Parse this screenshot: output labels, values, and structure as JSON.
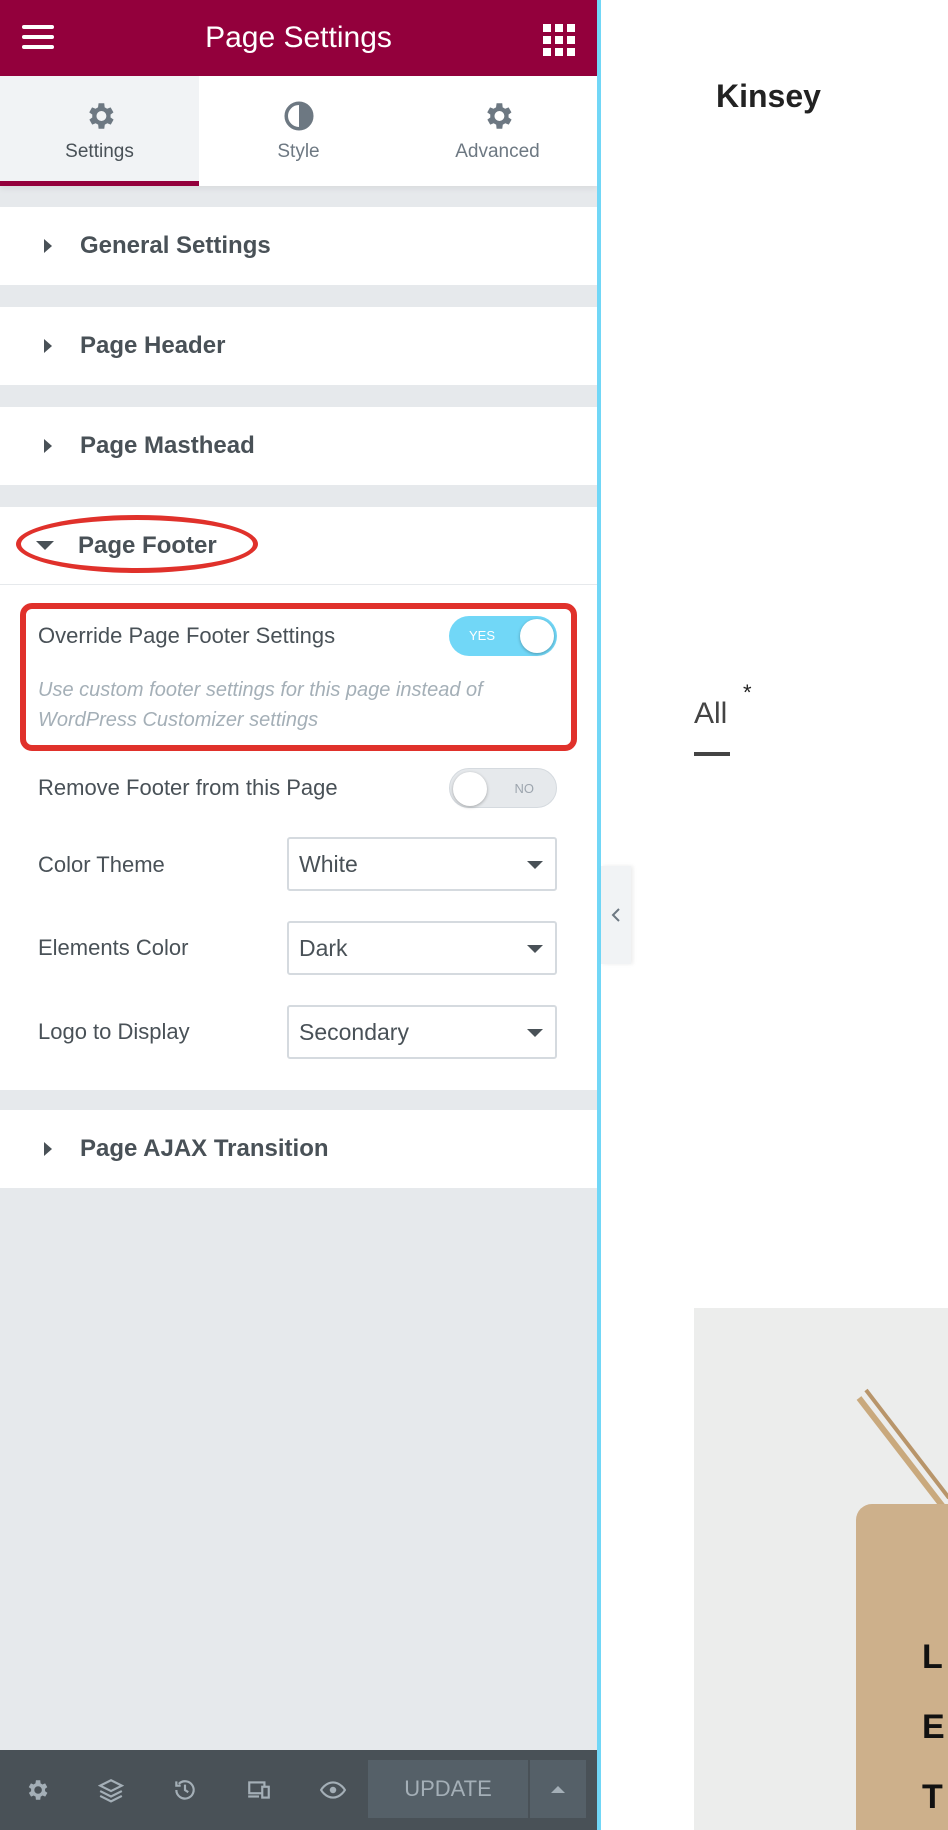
{
  "colors": {
    "brand": "#93003c",
    "toggle_on": "#71d7f7",
    "annotation": "#e0312b"
  },
  "header": {
    "title": "Page Settings",
    "menu_icon": "hamburger-icon",
    "apps_icon": "grid-icon"
  },
  "tabs": [
    {
      "label": "Settings",
      "icon": "gear-icon",
      "active": true
    },
    {
      "label": "Style",
      "icon": "half-circle-icon",
      "active": false
    },
    {
      "label": "Advanced",
      "icon": "gear-icon",
      "active": false
    }
  ],
  "sections": {
    "general": "General Settings",
    "header": "Page Header",
    "masthead": "Page Masthead",
    "footer": "Page Footer",
    "ajax": "Page AJAX Transition"
  },
  "footer_controls": {
    "override": {
      "label": "Override Page Footer Settings",
      "toggle": "YES",
      "description": "Use custom footer settings for this page instead of WordPress Customizer settings"
    },
    "remove": {
      "label": "Remove Footer from this Page",
      "toggle": "NO"
    },
    "color_theme": {
      "label": "Color Theme",
      "value": "White"
    },
    "elements_color": {
      "label": "Elements Color",
      "value": "Dark"
    },
    "logo": {
      "label": "Logo to Display",
      "value": "Secondary"
    }
  },
  "bottom_bar": {
    "update_label": "UPDATE",
    "icons": [
      "gear-icon",
      "layers-icon",
      "history-icon",
      "responsive-icon",
      "eye-icon"
    ]
  },
  "preview": {
    "site_title": "Kinsey",
    "filter_label": "All",
    "asterisk": "*",
    "tag_letters": [
      "L",
      "E",
      "T"
    ]
  }
}
